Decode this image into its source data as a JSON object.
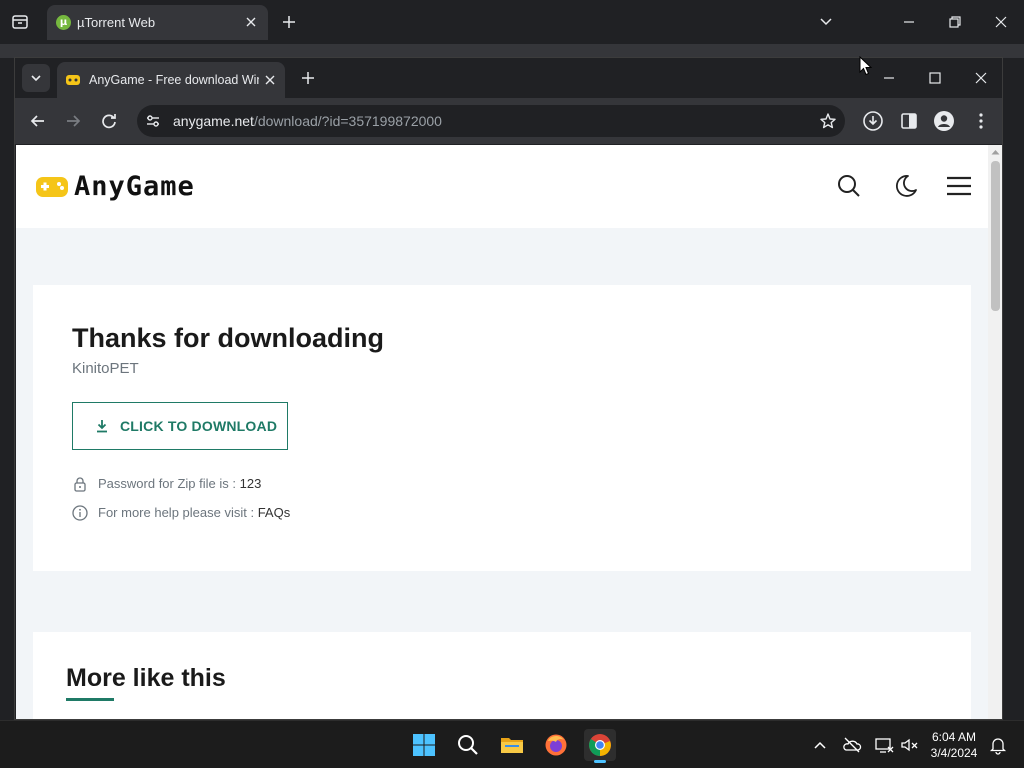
{
  "back_window": {
    "tab_title": "µTorrent Web",
    "tab_favicon_letter": "µ"
  },
  "browser": {
    "tab_title": "AnyGame - Free download Windows games",
    "url_host": "anygame.net",
    "url_path": "/download/?id=357199872000"
  },
  "page": {
    "logo_text": "AnyGame",
    "download": {
      "heading": "Thanks for downloading",
      "game_name": "KinitoPET",
      "button_label": "CLICK TO DOWNLOAD",
      "password_label": "Password for Zip file is : ",
      "password_value": "123",
      "help_label": "For more help please visit : ",
      "help_link": "FAQs"
    },
    "more_heading": "More like this"
  },
  "taskbar": {
    "time": "6:04 AM",
    "date": "3/4/2024",
    "apps": [
      "start-icon",
      "search-icon",
      "file-explorer-icon",
      "firefox-icon",
      "chrome-icon"
    ]
  },
  "colors": {
    "accent": "#1f7a66",
    "logo_yellow": "#f5c518",
    "page_bg": "#f2f5f8"
  }
}
